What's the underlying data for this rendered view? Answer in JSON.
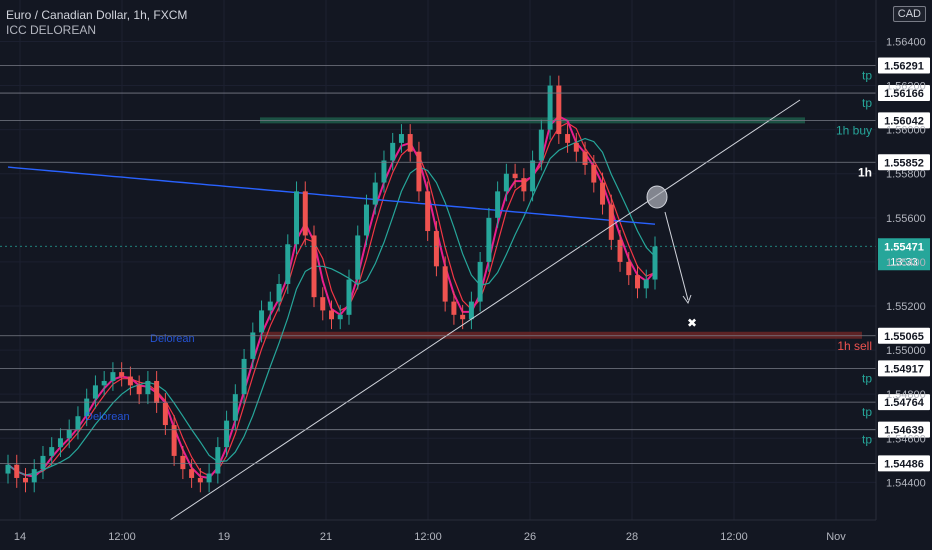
{
  "header": {
    "symbol_title": "Euro / Canadian Dollar, 1h, FXCM",
    "indicator": "ICC DELOREAN",
    "currency_badge": "CAD"
  },
  "colors": {
    "background": "#131722",
    "candle_up": "#26a69a",
    "candle_down": "#ef5350",
    "ma_fast": "#e91e8c",
    "ma_mid": "#f23645",
    "ma_teal": "#26a69a",
    "ma_slow": "#2962ff",
    "level_line": "#787b86",
    "buy_zone": "#1e5c4a",
    "sell_zone": "#6b2626",
    "tp_text": "#26a69a",
    "sell_text": "#ef5350"
  },
  "chart_data": {
    "type": "candlestick",
    "ylim": [
      1.5432,
      1.5652
    ],
    "y_ticks": [
      "1.56400",
      "1.56200",
      "1.56000",
      "1.55800",
      "1.55600",
      "1.55400",
      "1.55200",
      "1.55000",
      "1.54800",
      "1.54600",
      "1.54400"
    ],
    "x_ticks": [
      "14",
      "12:00",
      "19",
      "21",
      "12:00",
      "26",
      "28",
      "12:00",
      "Nov"
    ],
    "levels": [
      {
        "price": "1.56291",
        "label": "tp",
        "kind": "tp"
      },
      {
        "price": "1.56166",
        "label": "tp",
        "kind": "tp"
      },
      {
        "price": "1.56042",
        "label": "1h buy",
        "kind": "buy"
      },
      {
        "price": "1.55852",
        "label": "1h",
        "kind": "tf"
      },
      {
        "price": "1.55065",
        "label": "1h sell",
        "kind": "sell"
      },
      {
        "price": "1.54917",
        "label": "tp",
        "kind": "tp"
      },
      {
        "price": "1.54764",
        "label": "tp",
        "kind": "tp"
      },
      {
        "price": "1.54639",
        "label": "tp",
        "kind": "tp"
      },
      {
        "price": "1.54486",
        "label": "",
        "kind": "plain"
      }
    ],
    "current_price": "1.55471",
    "countdown": "13:33",
    "annotations": [
      "Delorean",
      "Delorean"
    ],
    "closes": [
      1.5448,
      1.5442,
      1.544,
      1.5446,
      1.5452,
      1.5456,
      1.546,
      1.5464,
      1.547,
      1.5478,
      1.5484,
      1.5486,
      1.549,
      1.5488,
      1.5484,
      1.548,
      1.5486,
      1.5476,
      1.5466,
      1.5452,
      1.5446,
      1.5442,
      1.544,
      1.5444,
      1.5456,
      1.5468,
      1.548,
      1.5496,
      1.5508,
      1.5518,
      1.5522,
      1.553,
      1.5548,
      1.5572,
      1.5552,
      1.5524,
      1.5518,
      1.5514,
      1.5516,
      1.5532,
      1.5552,
      1.5566,
      1.5576,
      1.5586,
      1.5594,
      1.5598,
      1.559,
      1.5572,
      1.5554,
      1.5538,
      1.5522,
      1.5516,
      1.5514,
      1.5522,
      1.554,
      1.556,
      1.5572,
      1.558,
      1.5578,
      1.5572,
      1.5586,
      1.56,
      1.562,
      1.5598,
      1.5594,
      1.559,
      1.5584,
      1.5576,
      1.5566,
      1.555,
      1.554,
      1.5534,
      1.5528,
      1.5532,
      1.5547
    ]
  }
}
